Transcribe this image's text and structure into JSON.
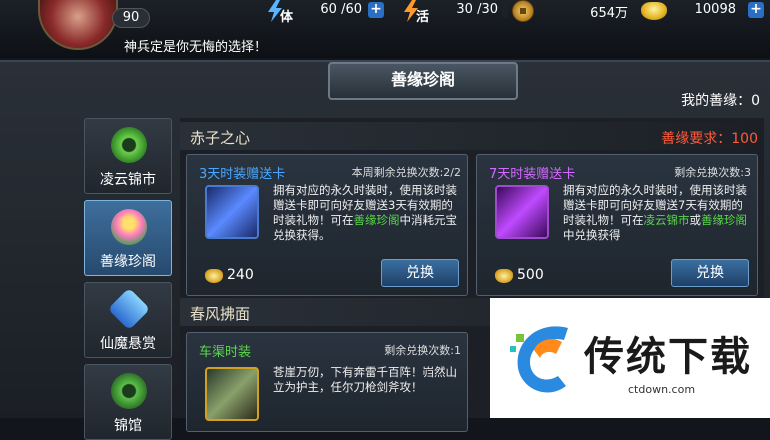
{
  "player": {
    "level": "90"
  },
  "resources": {
    "stamina": {
      "label": "体",
      "value": "60 /60"
    },
    "vitality": {
      "label": "活",
      "value": "30 /30"
    },
    "copper": {
      "value": "654万"
    },
    "gold": {
      "value": "10098"
    }
  },
  "marquee": "神兵定是你无悔的选择！",
  "panel": {
    "title": "善缘珍阁",
    "my_karma": "我的善缘：0"
  },
  "sidebar": {
    "items": [
      {
        "label": "凌云锦市",
        "icon": "jade-coin-icon",
        "active": false
      },
      {
        "label": "善缘珍阁",
        "icon": "lotus-icon",
        "active": true
      },
      {
        "label": "仙魔悬赏",
        "icon": "gem-icon",
        "active": false
      },
      {
        "label": "锦馆",
        "icon": "coin-icon",
        "active": false
      }
    ]
  },
  "sections": [
    {
      "title": "赤子之心",
      "requirement": "善缘要求：100",
      "cards": [
        {
          "name": "3天时装赠送卡",
          "remaining": "本周剩余兑换次数:2/2",
          "desc_a": "拥有对应的永久时装时，使用该时装赠送卡即可向好友赠送3天有效期的时装礼物！可在",
          "desc_link": "善缘珍阁",
          "desc_b": "中消耗元宝兑换获得。",
          "desc_link2": "",
          "desc_c": "",
          "price": "240",
          "button": "兑换",
          "color": "#4aa8ff"
        },
        {
          "name": "7天时装赠送卡",
          "remaining": "剩余兑换次数:3",
          "desc_a": "拥有对应的永久时装时，使用该时装赠送卡即可向好友赠送7天有效期的时装礼物！可在",
          "desc_link": "凌云锦市",
          "desc_b": "或",
          "desc_link2": "善缘珍阁",
          "desc_c": "中兑换获得",
          "price": "500",
          "button": "兑换",
          "color": "#d46aff"
        }
      ]
    },
    {
      "title": "春风拂面",
      "cards": [
        {
          "name": "车渠时装",
          "remaining": "剩余兑换次数:1",
          "desc": "苍崖万仞，下有奔雷千百阵！岿然山立为护主，任尔刀枪剑斧攻！",
          "color": "#5ad84a"
        }
      ]
    }
  ],
  "watermark": {
    "brand": "传统下载",
    "url": "ctdown.com"
  }
}
